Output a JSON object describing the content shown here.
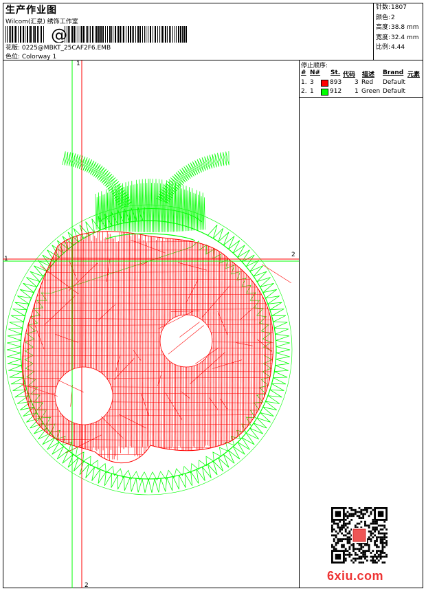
{
  "header": {
    "title": "生产作业图",
    "company": "Wilcom(汇泉) 绣饰工作室",
    "barcode_char": "@",
    "design": "花版: 0225@MBKT_25CAF2F6.EMB",
    "colorway": "色位: Colorway 1"
  },
  "stats": [
    {
      "label": "针数:",
      "value": "1807"
    },
    {
      "label": "颜色:",
      "value": "2"
    },
    {
      "label": "高度:",
      "value": "38.8 mm"
    },
    {
      "label": "宽度:",
      "value": "32.4 mm"
    },
    {
      "label": "比例:",
      "value": "4.44"
    }
  ],
  "stop_sequence": {
    "title": "停止顺序:",
    "columns": [
      "#",
      "N#",
      "St.",
      "代码",
      "描述",
      "Brand",
      "元素"
    ],
    "rows": [
      {
        "index": "1.",
        "n": "3",
        "color": "#ff0000",
        "stitches": "893",
        "code": "3",
        "desc": "Red",
        "brand": "Default"
      },
      {
        "index": "2.",
        "n": "1",
        "color": "#00ff00",
        "stitches": "912",
        "code": "1",
        "desc": "Green",
        "brand": "Default"
      }
    ]
  },
  "axes": {
    "v_top": "1",
    "h_left": "1",
    "h_right": "2",
    "v_bottom": "2"
  },
  "watermark": "6xiu.com",
  "colors": {
    "red": "#ff0000",
    "green": "#00ff00"
  }
}
